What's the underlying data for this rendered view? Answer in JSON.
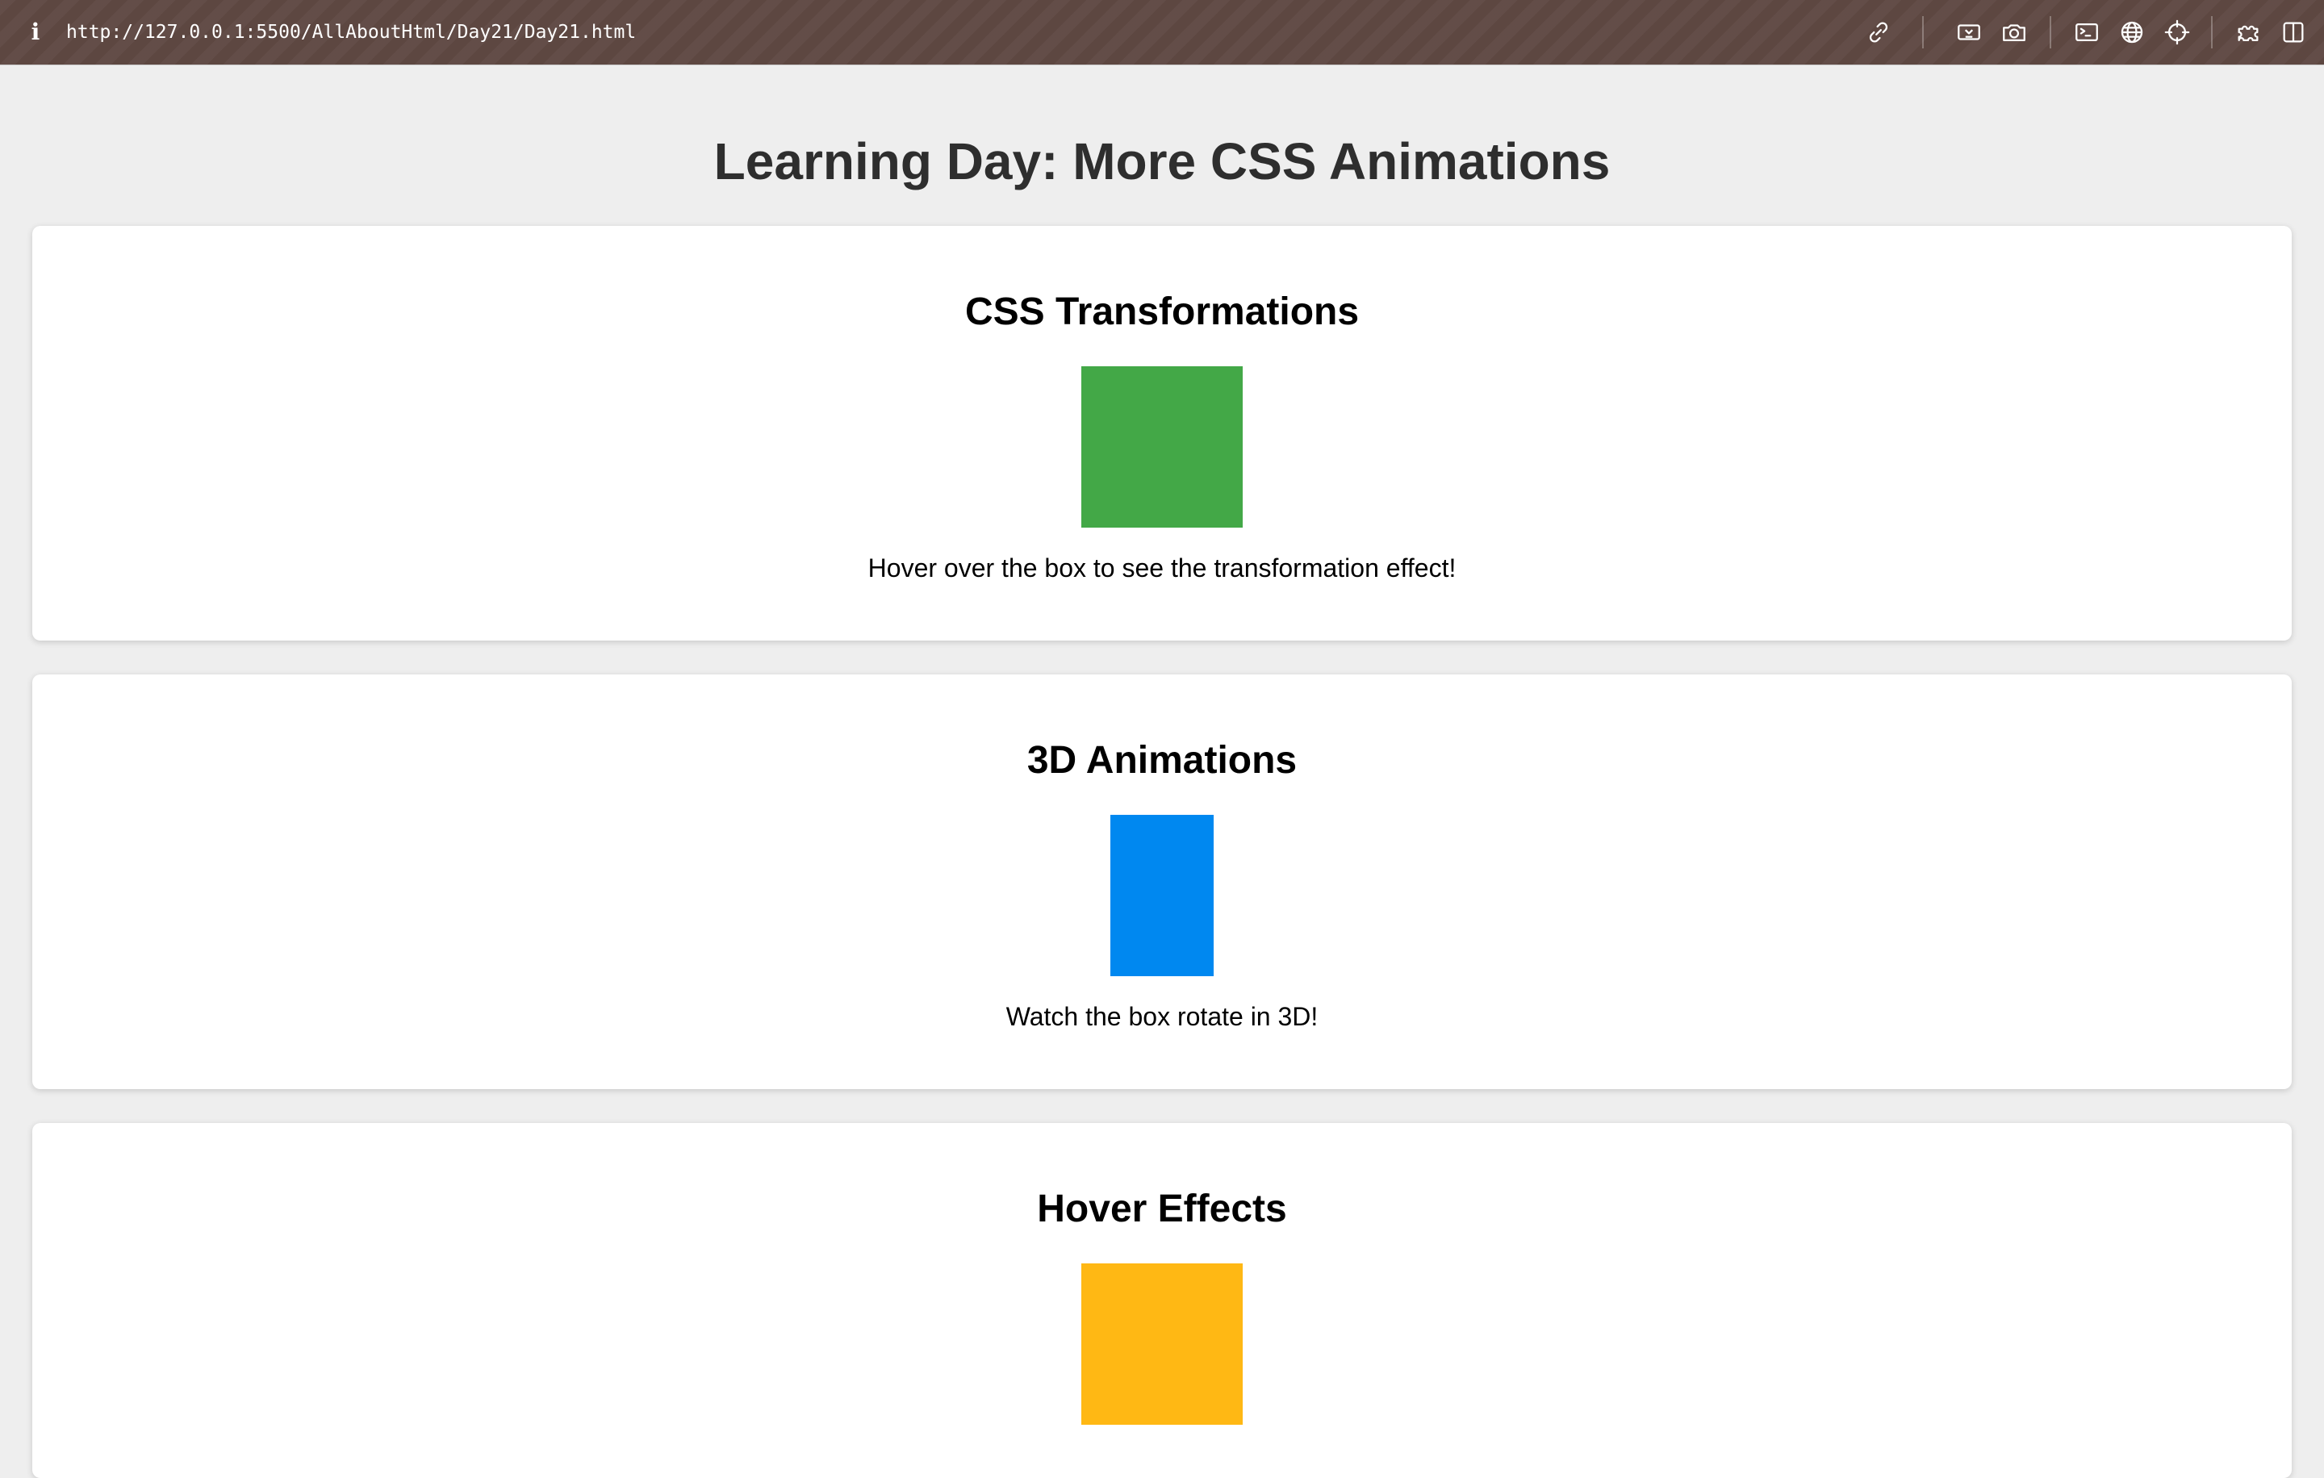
{
  "browser": {
    "url": "http://127.0.0.1:5500/AllAboutHtml/Day21/Day21.html",
    "info_icon": "i",
    "toolbar_icons": [
      "link-icon",
      "responsive-view-icon",
      "camera-icon",
      "terminal-icon",
      "globe-icon",
      "crosshair-icon",
      "extensions-icon",
      "sidebar-icon"
    ]
  },
  "page": {
    "title": "Learning Day: More CSS Animations",
    "background": "#eeeeee"
  },
  "sections": [
    {
      "title": "CSS Transformations",
      "box_color": "#43a847",
      "description": "Hover over the box to see the transformation effect!"
    },
    {
      "title": "3D Animations",
      "box_color": "#0088f0",
      "description": "Watch the box rotate in 3D!"
    },
    {
      "title": "Hover Effects",
      "box_color": "#ffb814",
      "description": ""
    }
  ]
}
